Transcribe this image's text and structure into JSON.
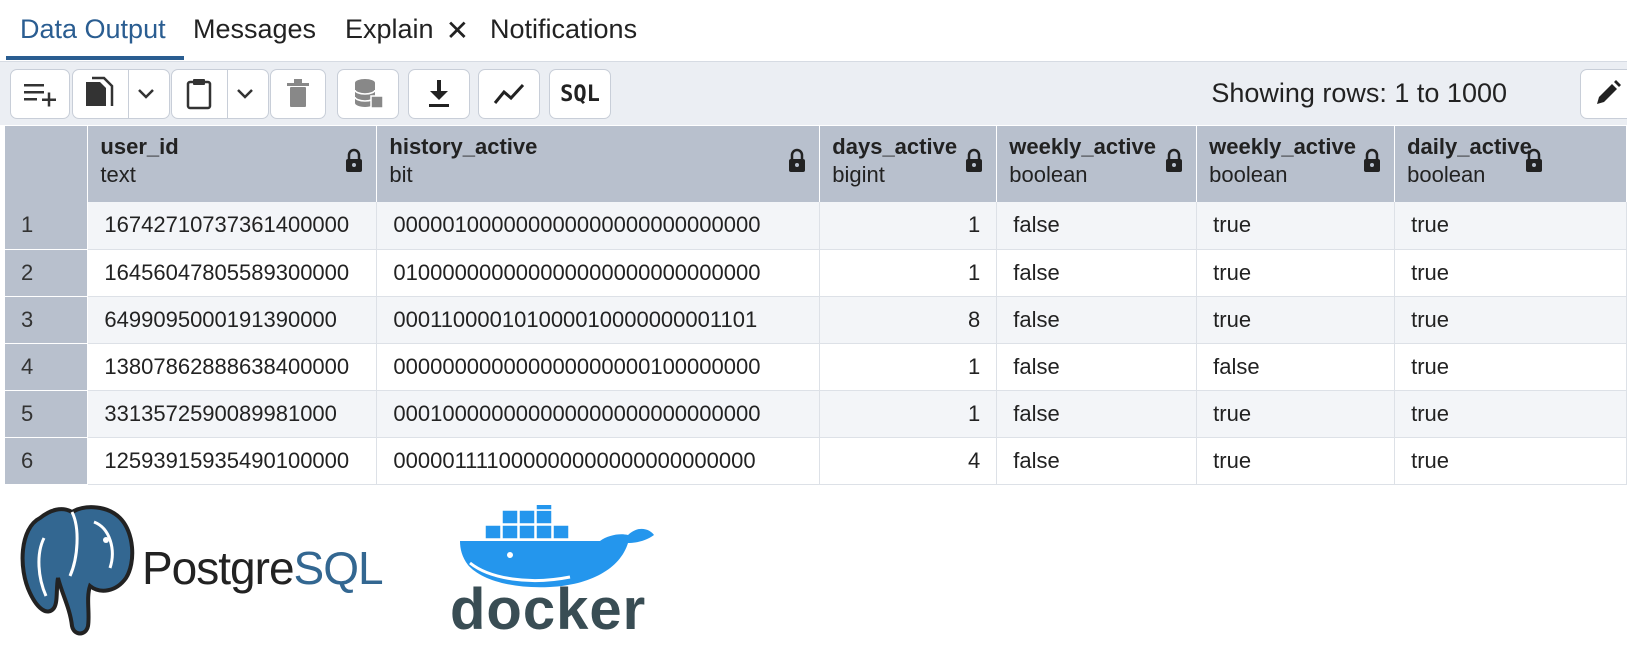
{
  "tabs": [
    {
      "label": "Data Output"
    },
    {
      "label": "Messages"
    },
    {
      "label": "Explain"
    },
    {
      "label": "Notifications"
    }
  ],
  "tab_close_icon": "close-icon",
  "toolbar": {
    "buttons": [
      "add-row-icon",
      "copy-icon",
      "dropdown-icon",
      "paste-icon",
      "dropdown-icon",
      "delete-icon",
      "save-data-icon",
      "download-icon",
      "graph-icon",
      "sql-icon"
    ],
    "sql_label": "SQL",
    "rows_text": "Showing rows: 1 to 1000",
    "edit_icon": "pencil-icon"
  },
  "columns": [
    {
      "name": "user_id",
      "type": "text"
    },
    {
      "name": "history_active",
      "type": "bit"
    },
    {
      "name": "days_active",
      "type": "bigint"
    },
    {
      "name": "weekly_active",
      "type": "boolean"
    },
    {
      "name": "weekly_active",
      "type": "boolean"
    },
    {
      "name": "daily_active",
      "type": "boolean"
    }
  ],
  "rows": [
    {
      "n": "1",
      "cells": [
        "16742710737361400000",
        "000001000000000000000000000000",
        "1",
        "false",
        "true",
        "true"
      ]
    },
    {
      "n": "2",
      "cells": [
        "16456047805589300000",
        "010000000000000000000000000000",
        "1",
        "false",
        "true",
        "true"
      ]
    },
    {
      "n": "3",
      "cells": [
        "6499095000191390000",
        "000110000101000010000000001101",
        "8",
        "false",
        "true",
        "true"
      ]
    },
    {
      "n": "4",
      "cells": [
        "13807862888638400000",
        "000000000000000000000100000000",
        "1",
        "false",
        "false",
        "true"
      ]
    },
    {
      "n": "5",
      "cells": [
        "3313572590089981000",
        "000100000000000000000000000000",
        "1",
        "false",
        "true",
        "true"
      ]
    },
    {
      "n": "6",
      "cells": [
        "12593915935490100000",
        "000001111000000000000000000000",
        "4",
        "false",
        "true",
        "true"
      ]
    }
  ],
  "logos": {
    "postgres_prefix": "Postgre",
    "postgres_suffix": "SQL",
    "docker": "docker"
  },
  "colors": {
    "accent": "#2a5d91",
    "header_bg": "#b8c0cd",
    "toolbar_bg": "#ebeef3",
    "postgres_blue": "#336791",
    "docker_blue": "#2496ed"
  }
}
